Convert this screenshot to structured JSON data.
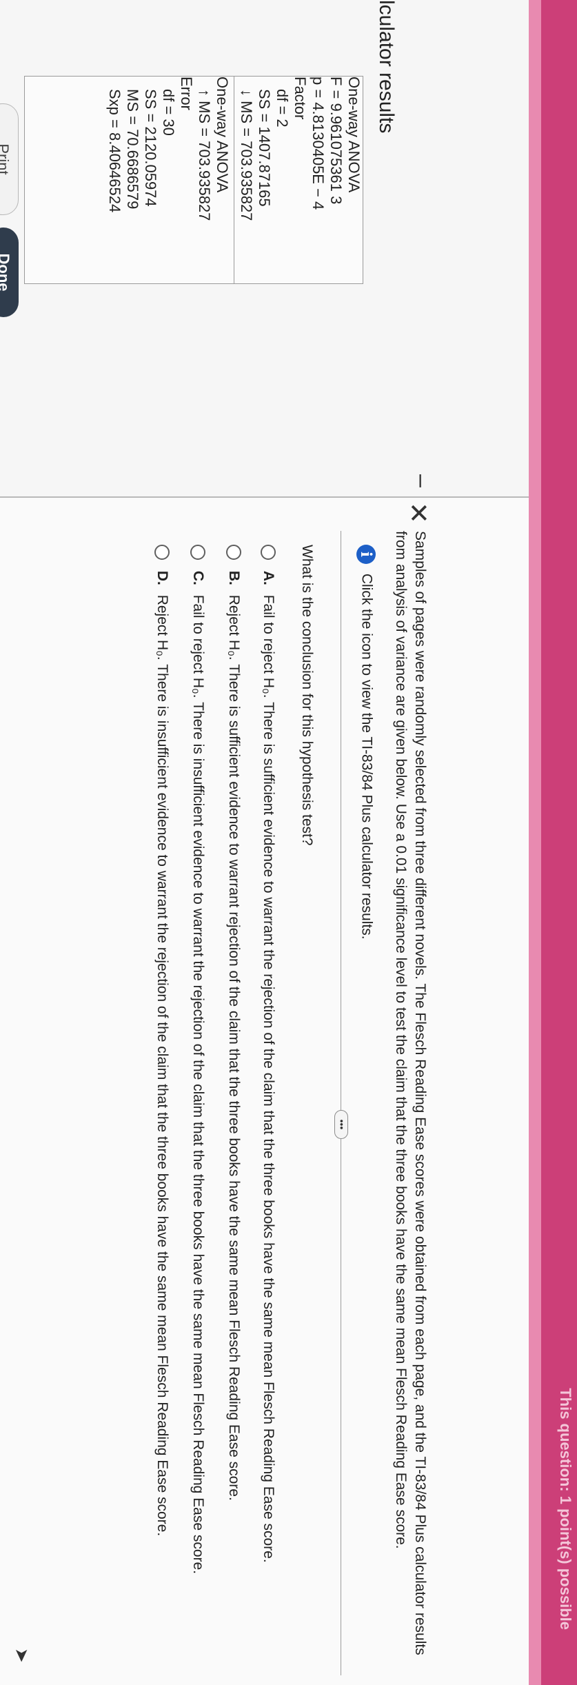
{
  "header": {
    "bar_text": "This question: 1 point(s) possible"
  },
  "dialog": {
    "title": "lculator results",
    "minimize_label": "–",
    "close_label": "✕",
    "calc": {
      "l1": "One-way ANOVA",
      "l2": "F = 9.961075361 3",
      "l3": "p = 4.8130405E − 4",
      "l4": "Factor",
      "l5": "df = 2",
      "l6": "SS = 1407.87165",
      "l7": "↓ MS = 703.935827",
      "l8": "One-way ANOVA",
      "l9": "↑ MS = 703.935827",
      "l10": "Error",
      "l11": "df = 30",
      "l12": "SS = 2120.05974",
      "l13": "MS = 70.6686579",
      "l14": "Sxp = 8.40646524"
    },
    "print_label": "Print",
    "done_label": "Done"
  },
  "question": {
    "intro": "Samples of pages were randomly selected from three different novels. The Flesch Reading Ease scores were obtained from each page, and the TI-83/84 Plus calculator results from analysis of variance are given below. Use a 0.01 significance level to test the claim that the three books have the same mean Flesch Reading Ease score.",
    "info_text": "Click the icon to view the TI-83/84 Plus calculator results.",
    "more_label": "•••",
    "prompt": "What is the conclusion for this hypothesis test?",
    "options": [
      {
        "letter": "A.",
        "text": "Fail to reject H₀. There is sufficient evidence to warrant the rejection of the claim that the three books have the same mean Flesch Reading Ease score."
      },
      {
        "letter": "B.",
        "text": "Reject H₀. There is sufficient evidence to warrant rejection of the claim that the three books have the same mean Flesch Reading Ease score."
      },
      {
        "letter": "C.",
        "text": "Fail to reject H₀. There is insufficient evidence to warrant the rejection of the claim that the three books have the same mean Flesch Reading Ease score."
      },
      {
        "letter": "D.",
        "text": "Reject H₀. There is insufficient evidence to warrant the rejection of the claim that the three books have the same mean Flesch Reading Ease score."
      }
    ]
  }
}
